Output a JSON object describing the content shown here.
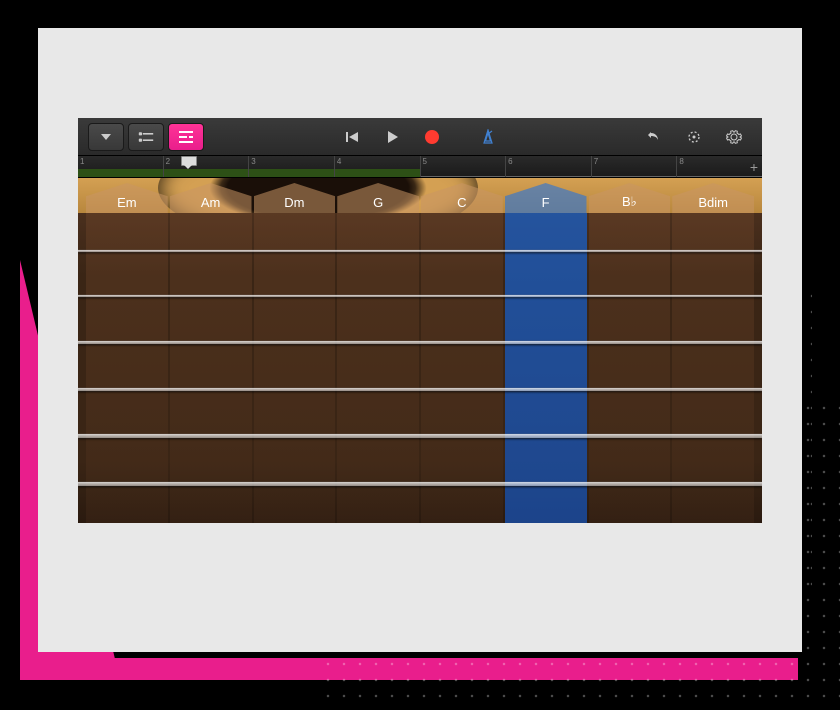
{
  "toolbar": {
    "browser_label": "browser",
    "view_tracks_label": "tracks",
    "view_chord_label": "chord-strips",
    "rewind_label": "rewind",
    "play_label": "play",
    "record_label": "record",
    "metronome_label": "metronome",
    "undo_label": "undo",
    "master_label": "master-effects",
    "settings_label": "settings"
  },
  "ruler": {
    "bars": [
      "1",
      "2",
      "3",
      "4",
      "5",
      "6",
      "7",
      "8"
    ],
    "add_label": "+"
  },
  "chords": [
    "Em",
    "Am",
    "Dm",
    "G",
    "C",
    "F",
    "B♭",
    "Bdim"
  ],
  "selected_chord_index": 5,
  "strings_count": 6
}
